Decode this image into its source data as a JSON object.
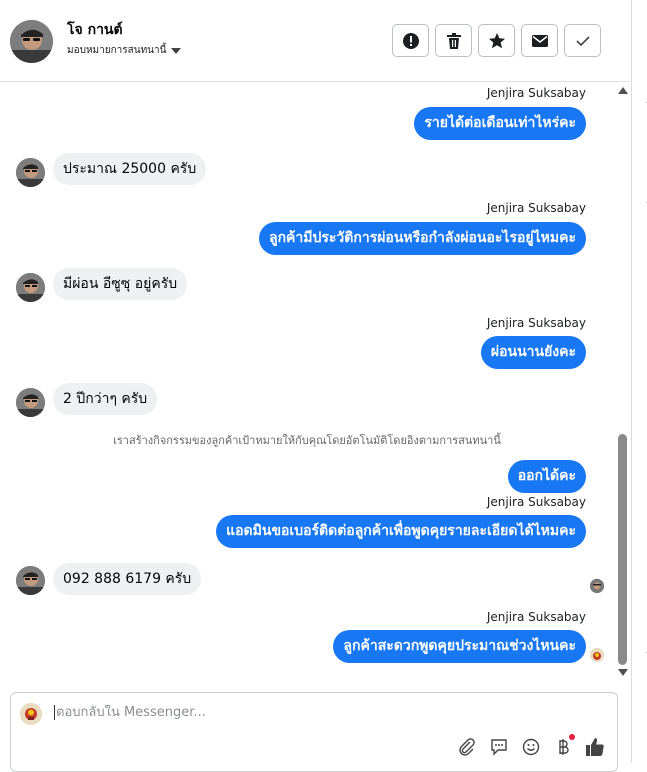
{
  "contact": {
    "name": "โจ กานต์",
    "assign_label": "มอบหมายการสนทนานี้"
  },
  "actions": [
    {
      "name": "report-button",
      "icon": "exclamation-icon"
    },
    {
      "name": "delete-button",
      "icon": "trash-icon"
    },
    {
      "name": "star-button",
      "icon": "star-icon"
    },
    {
      "name": "mark-unread-button",
      "icon": "envelope-icon"
    },
    {
      "name": "mark-done-button",
      "icon": "checkmark-icon"
    }
  ],
  "messages": {
    "m1_sender": "Jenjira Suksabay",
    "m1_text": "รายได้ต่อเดือนเท่าไหร่คะ",
    "m2_text": "ประมาณ 25000 ครับ",
    "m3_sender": "Jenjira Suksabay",
    "m3_text": "ลูกค้ามีประวัติการผ่อนหรือกำลังผ่อนอะไรอยู่ไหมคะ",
    "m4_text": "มีผ่อน อีซูซุ อยู่ครับ",
    "m5_sender": "Jenjira Suksabay",
    "m5_text": "ผ่อนนานยังคะ",
    "m6_text": "2 ปีกว่าๆ ครับ",
    "system_note": "เราสร้างกิจกรรมของลูกค้าเป้าหมายให้กับคุณโดยอัตโนมัติโดยอิงตามการสนทนานี้",
    "m7_text": "ออกได้คะ",
    "m8_sender": "Jenjira Suksabay",
    "m8_text": "แอดมินขอเบอร์ติดต่อลูกค้าเพื่อพูดคุยรายละเอียดได้ไหมคะ",
    "m9_text": "092 888 6179 ครับ",
    "m10_sender": "Jenjira Suksabay",
    "m10_text": "ลูกค้าสะดวกพูดคุยประมาณช่วงไหนคะ"
  },
  "composer": {
    "placeholder": "ตอบกลับใน Messenger..."
  },
  "colors": {
    "outgoing_bubble": "#1877f2",
    "incoming_bubble": "#eff0f2",
    "notification_dot": "#e41e3f"
  },
  "icons": {
    "composer_tools": [
      "attachment-icon",
      "saved-replies-icon",
      "emoji-icon",
      "payment-icon",
      "like-icon"
    ]
  }
}
